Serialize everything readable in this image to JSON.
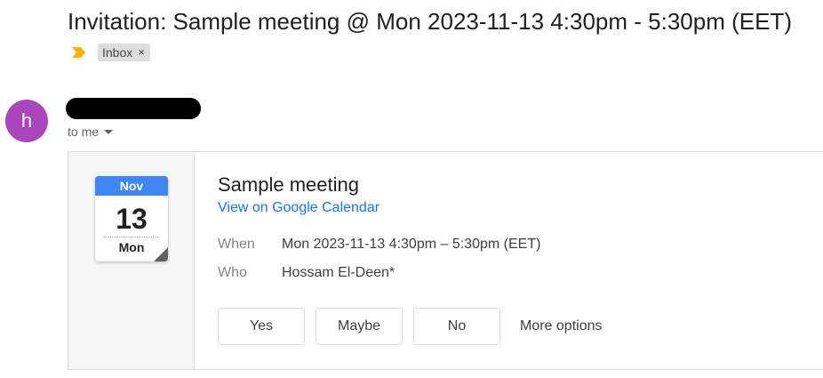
{
  "email": {
    "subject": "Invitation: Sample meeting @ Mon 2023-11-13 4:30pm - 5:30pm (EET)",
    "labels": [
      {
        "name": "Inbox",
        "remove_glyph": "×"
      }
    ],
    "important_marker_color": "#f4b400",
    "sender": {
      "avatar_letter": "h",
      "avatar_color": "#ab47bc",
      "name_redacted": true
    },
    "recipient_text": "to me"
  },
  "invite": {
    "calendar_icon": {
      "month": "Nov",
      "day": "13",
      "weekday": "Mon",
      "accent_color": "#4285f4"
    },
    "title": "Sample meeting",
    "calendar_link": "View on Google Calendar",
    "details": {
      "when_label": "When",
      "when_value": "Mon 2023-11-13 4:30pm – 5:30pm (EET)",
      "who_label": "Who",
      "who_value": "Hossam El-Deen*"
    },
    "rsvp": {
      "yes": "Yes",
      "maybe": "Maybe",
      "no": "No",
      "more": "More options"
    }
  }
}
